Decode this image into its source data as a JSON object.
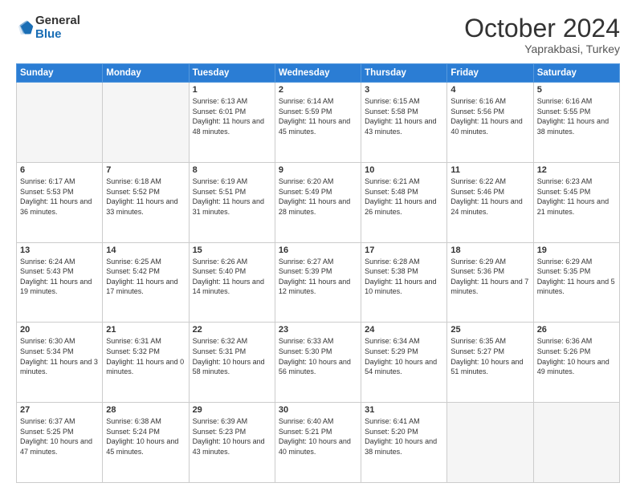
{
  "header": {
    "logo_line1": "General",
    "logo_line2": "Blue",
    "month_year": "October 2024",
    "location": "Yaprakbasi, Turkey"
  },
  "weekdays": [
    "Sunday",
    "Monday",
    "Tuesday",
    "Wednesday",
    "Thursday",
    "Friday",
    "Saturday"
  ],
  "weeks": [
    [
      {
        "day": "",
        "sunrise": "",
        "sunset": "",
        "daylight": ""
      },
      {
        "day": "",
        "sunrise": "",
        "sunset": "",
        "daylight": ""
      },
      {
        "day": "1",
        "sunrise": "Sunrise: 6:13 AM",
        "sunset": "Sunset: 6:01 PM",
        "daylight": "Daylight: 11 hours and 48 minutes."
      },
      {
        "day": "2",
        "sunrise": "Sunrise: 6:14 AM",
        "sunset": "Sunset: 5:59 PM",
        "daylight": "Daylight: 11 hours and 45 minutes."
      },
      {
        "day": "3",
        "sunrise": "Sunrise: 6:15 AM",
        "sunset": "Sunset: 5:58 PM",
        "daylight": "Daylight: 11 hours and 43 minutes."
      },
      {
        "day": "4",
        "sunrise": "Sunrise: 6:16 AM",
        "sunset": "Sunset: 5:56 PM",
        "daylight": "Daylight: 11 hours and 40 minutes."
      },
      {
        "day": "5",
        "sunrise": "Sunrise: 6:16 AM",
        "sunset": "Sunset: 5:55 PM",
        "daylight": "Daylight: 11 hours and 38 minutes."
      }
    ],
    [
      {
        "day": "6",
        "sunrise": "Sunrise: 6:17 AM",
        "sunset": "Sunset: 5:53 PM",
        "daylight": "Daylight: 11 hours and 36 minutes."
      },
      {
        "day": "7",
        "sunrise": "Sunrise: 6:18 AM",
        "sunset": "Sunset: 5:52 PM",
        "daylight": "Daylight: 11 hours and 33 minutes."
      },
      {
        "day": "8",
        "sunrise": "Sunrise: 6:19 AM",
        "sunset": "Sunset: 5:51 PM",
        "daylight": "Daylight: 11 hours and 31 minutes."
      },
      {
        "day": "9",
        "sunrise": "Sunrise: 6:20 AM",
        "sunset": "Sunset: 5:49 PM",
        "daylight": "Daylight: 11 hours and 28 minutes."
      },
      {
        "day": "10",
        "sunrise": "Sunrise: 6:21 AM",
        "sunset": "Sunset: 5:48 PM",
        "daylight": "Daylight: 11 hours and 26 minutes."
      },
      {
        "day": "11",
        "sunrise": "Sunrise: 6:22 AM",
        "sunset": "Sunset: 5:46 PM",
        "daylight": "Daylight: 11 hours and 24 minutes."
      },
      {
        "day": "12",
        "sunrise": "Sunrise: 6:23 AM",
        "sunset": "Sunset: 5:45 PM",
        "daylight": "Daylight: 11 hours and 21 minutes."
      }
    ],
    [
      {
        "day": "13",
        "sunrise": "Sunrise: 6:24 AM",
        "sunset": "Sunset: 5:43 PM",
        "daylight": "Daylight: 11 hours and 19 minutes."
      },
      {
        "day": "14",
        "sunrise": "Sunrise: 6:25 AM",
        "sunset": "Sunset: 5:42 PM",
        "daylight": "Daylight: 11 hours and 17 minutes."
      },
      {
        "day": "15",
        "sunrise": "Sunrise: 6:26 AM",
        "sunset": "Sunset: 5:40 PM",
        "daylight": "Daylight: 11 hours and 14 minutes."
      },
      {
        "day": "16",
        "sunrise": "Sunrise: 6:27 AM",
        "sunset": "Sunset: 5:39 PM",
        "daylight": "Daylight: 11 hours and 12 minutes."
      },
      {
        "day": "17",
        "sunrise": "Sunrise: 6:28 AM",
        "sunset": "Sunset: 5:38 PM",
        "daylight": "Daylight: 11 hours and 10 minutes."
      },
      {
        "day": "18",
        "sunrise": "Sunrise: 6:29 AM",
        "sunset": "Sunset: 5:36 PM",
        "daylight": "Daylight: 11 hours and 7 minutes."
      },
      {
        "day": "19",
        "sunrise": "Sunrise: 6:29 AM",
        "sunset": "Sunset: 5:35 PM",
        "daylight": "Daylight: 11 hours and 5 minutes."
      }
    ],
    [
      {
        "day": "20",
        "sunrise": "Sunrise: 6:30 AM",
        "sunset": "Sunset: 5:34 PM",
        "daylight": "Daylight: 11 hours and 3 minutes."
      },
      {
        "day": "21",
        "sunrise": "Sunrise: 6:31 AM",
        "sunset": "Sunset: 5:32 PM",
        "daylight": "Daylight: 11 hours and 0 minutes."
      },
      {
        "day": "22",
        "sunrise": "Sunrise: 6:32 AM",
        "sunset": "Sunset: 5:31 PM",
        "daylight": "Daylight: 10 hours and 58 minutes."
      },
      {
        "day": "23",
        "sunrise": "Sunrise: 6:33 AM",
        "sunset": "Sunset: 5:30 PM",
        "daylight": "Daylight: 10 hours and 56 minutes."
      },
      {
        "day": "24",
        "sunrise": "Sunrise: 6:34 AM",
        "sunset": "Sunset: 5:29 PM",
        "daylight": "Daylight: 10 hours and 54 minutes."
      },
      {
        "day": "25",
        "sunrise": "Sunrise: 6:35 AM",
        "sunset": "Sunset: 5:27 PM",
        "daylight": "Daylight: 10 hours and 51 minutes."
      },
      {
        "day": "26",
        "sunrise": "Sunrise: 6:36 AM",
        "sunset": "Sunset: 5:26 PM",
        "daylight": "Daylight: 10 hours and 49 minutes."
      }
    ],
    [
      {
        "day": "27",
        "sunrise": "Sunrise: 6:37 AM",
        "sunset": "Sunset: 5:25 PM",
        "daylight": "Daylight: 10 hours and 47 minutes."
      },
      {
        "day": "28",
        "sunrise": "Sunrise: 6:38 AM",
        "sunset": "Sunset: 5:24 PM",
        "daylight": "Daylight: 10 hours and 45 minutes."
      },
      {
        "day": "29",
        "sunrise": "Sunrise: 6:39 AM",
        "sunset": "Sunset: 5:23 PM",
        "daylight": "Daylight: 10 hours and 43 minutes."
      },
      {
        "day": "30",
        "sunrise": "Sunrise: 6:40 AM",
        "sunset": "Sunset: 5:21 PM",
        "daylight": "Daylight: 10 hours and 40 minutes."
      },
      {
        "day": "31",
        "sunrise": "Sunrise: 6:41 AM",
        "sunset": "Sunset: 5:20 PM",
        "daylight": "Daylight: 10 hours and 38 minutes."
      },
      {
        "day": "",
        "sunrise": "",
        "sunset": "",
        "daylight": ""
      },
      {
        "day": "",
        "sunrise": "",
        "sunset": "",
        "daylight": ""
      }
    ]
  ]
}
